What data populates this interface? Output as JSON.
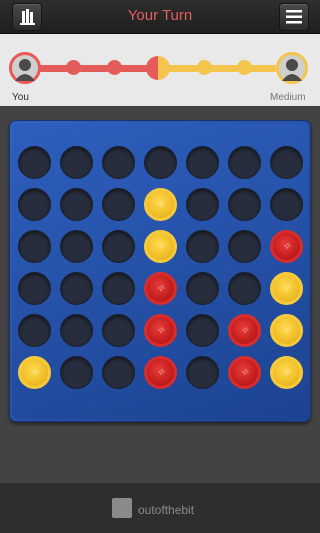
{
  "header": {
    "title": "Your Turn",
    "left_icon": "trophy-icon",
    "right_icon": "menu-icon"
  },
  "players": {
    "you": "You",
    "opponent": "Medium"
  },
  "colors": {
    "player": "#e45c5a",
    "opponent": "#f3c54d",
    "board": "#2f63bf"
  },
  "board": {
    "columns": 7,
    "rows": 6,
    "grid": [
      [
        "empty",
        "empty",
        "empty",
        "empty",
        "empty",
        "empty",
        "empty"
      ],
      [
        "empty",
        "empty",
        "empty",
        "yellow",
        "empty",
        "empty",
        "empty"
      ],
      [
        "empty",
        "empty",
        "empty",
        "yellow",
        "empty",
        "empty",
        "red"
      ],
      [
        "empty",
        "empty",
        "empty",
        "red",
        "empty",
        "empty",
        "yellow"
      ],
      [
        "empty",
        "empty",
        "empty",
        "red",
        "empty",
        "red",
        "yellow"
      ],
      [
        "yellow",
        "empty",
        "empty",
        "red",
        "empty",
        "red",
        "yellow"
      ]
    ]
  },
  "footer": {
    "brand": "outofthebit"
  }
}
